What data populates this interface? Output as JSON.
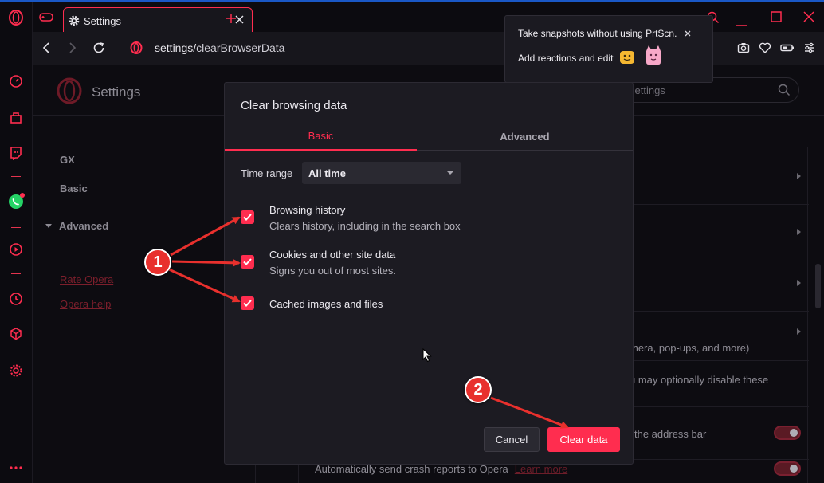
{
  "browser": {
    "tab": {
      "title": "Settings"
    },
    "address": {
      "scheme": "settings/",
      "path": "clearBrowserData"
    }
  },
  "gx_sidebar": {
    "items": [
      "speed-dial",
      "shopping",
      "twitch",
      "whatsapp",
      "player",
      "history",
      "extensions",
      "settings",
      "more"
    ]
  },
  "popup": {
    "line1": "Take snapshots without using PrtScn.",
    "line2": "Add reactions and edit"
  },
  "settings": {
    "title": "Settings",
    "search_placeholder": "settings",
    "nav": {
      "gx": "GX",
      "basic": "Basic",
      "advanced": "Advanced",
      "rate": "Rate Opera",
      "help": "Opera help"
    },
    "rows": {
      "partial1": "mera, pop-ups, and more)",
      "partial2": "u may optionally disable these",
      "partial3": "the address bar",
      "crash": "Automatically send crash reports to Opera",
      "learn_more": "Learn more"
    }
  },
  "dialog": {
    "title": "Clear browsing data",
    "tabs": {
      "basic": "Basic",
      "advanced": "Advanced"
    },
    "time_range_label": "Time range",
    "time_range_value": "All time",
    "items": [
      {
        "title": "Browsing history",
        "desc": "Clears history, including in the search box",
        "checked": true
      },
      {
        "title": "Cookies and other site data",
        "desc": "Signs you out of most sites.",
        "checked": true
      },
      {
        "title": "Cached images and files",
        "desc": "",
        "checked": true
      }
    ],
    "cancel_label": "Cancel",
    "clear_label": "Clear data"
  },
  "annotations": {
    "badge1": "1",
    "badge2": "2"
  },
  "colors": {
    "accent": "#ff2d4f",
    "annotation": "#e8302d",
    "background": "#0d0c11"
  }
}
